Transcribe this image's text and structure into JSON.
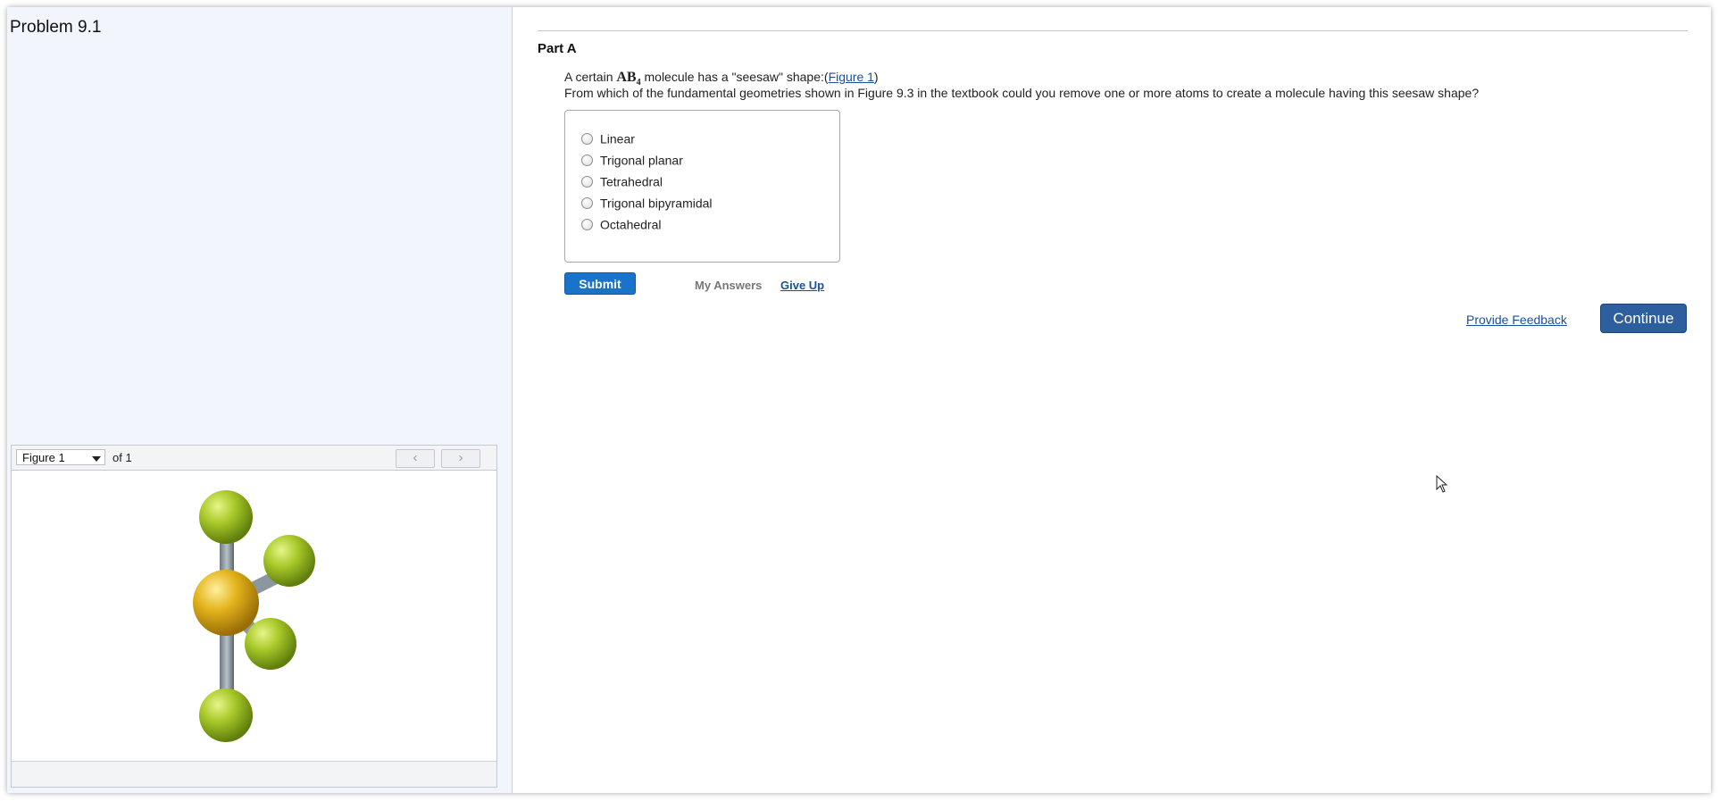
{
  "left_panel": {
    "problem_title": "Problem 9.1",
    "figure_viewer": {
      "selected_figure": "Figure 1",
      "of_label": "of 1",
      "prev_icon": "‹",
      "next_icon": "›"
    }
  },
  "part": {
    "title": "Part A",
    "question_prefix": "A certain ",
    "formula_main": "AB",
    "formula_sub": "4",
    "question_mid": " molecule has a \"seesaw\" shape:(",
    "figure_link": "Figure 1",
    "question_suffix": ")",
    "question_line2": "From which of the fundamental geometries shown in Figure 9.3 in the textbook could you remove one or more atoms to create a molecule having this seesaw shape?",
    "choices": [
      "Linear",
      "Trigonal planar",
      "Tetrahedral",
      "Trigonal bipyramidal",
      "Octahedral"
    ],
    "submit_label": "Submit",
    "my_answers_label": "My Answers",
    "give_up_label": "Give Up"
  },
  "footer": {
    "feedback_label": "Provide Feedback",
    "continue_label": "Continue"
  },
  "colors": {
    "left_panel_bg": "#f2f6fc",
    "submit_bg": "#1a73c8",
    "continue_bg": "#2d5f9e",
    "link": "#1a4f9c",
    "atom_outer": "#9bbf1e",
    "atom_central": "#e0b01a"
  }
}
